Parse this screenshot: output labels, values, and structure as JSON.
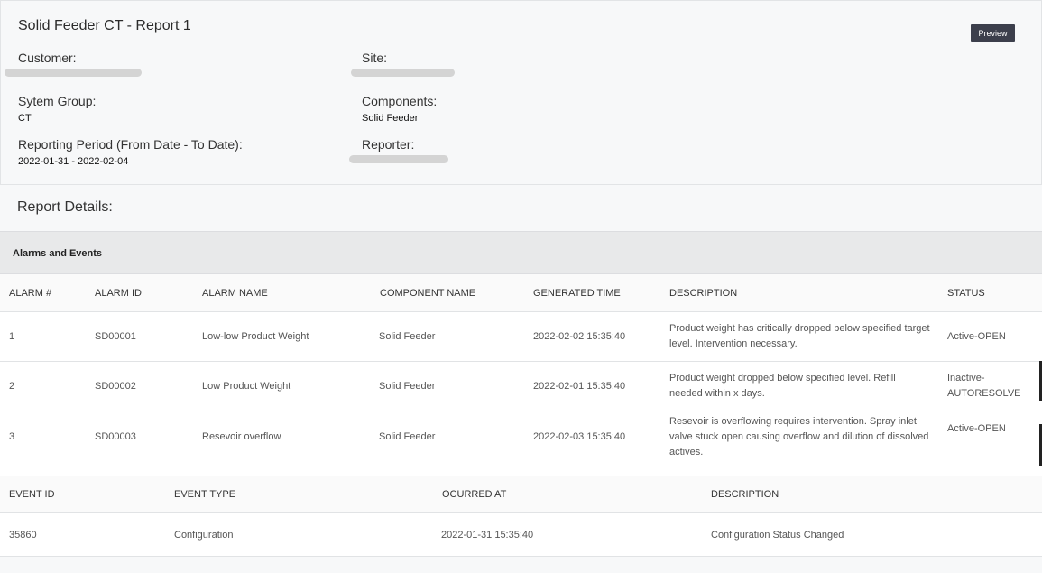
{
  "report": {
    "title": "Solid Feeder CT - Report 1",
    "preview_label": "Preview",
    "fields": {
      "customer_label": "Customer:",
      "site_label": "Site:",
      "system_group_label": "Sytem Group:",
      "system_group_value": "CT",
      "components_label": "Components:",
      "components_value": "Solid Feeder",
      "period_label": "Reporting Period (From Date - To Date):",
      "period_value": "2022-01-31 - 2022-02-04",
      "reporter_label": "Reporter:"
    },
    "details_title": "Report Details:"
  },
  "alarms": {
    "section_title": "Alarms and Events",
    "columns": [
      "ALARM #",
      "ALARM ID",
      "ALARM NAME",
      "COMPONENT NAME",
      "GENERATED TIME",
      "DESCRIPTION",
      "STATUS"
    ],
    "rows": [
      {
        "num": "1",
        "id": "SD00001",
        "name": "Low-low Product Weight",
        "component": "Solid Feeder",
        "time": "2022-02-02 15:35:40",
        "description": "Product weight has critically dropped below specified target level. Intervention necessary.",
        "status": "Active-OPEN"
      },
      {
        "num": "2",
        "id": "SD00002",
        "name": "Low Product Weight",
        "component": "Solid Feeder",
        "time": "2022-02-01 15:35:40",
        "description": "Product weight dropped below specified level. Refill needed within x days.",
        "status": "Inactive-AUTORESOLVE"
      },
      {
        "num": "3",
        "id": "SD00003",
        "name": "Resevoir overflow",
        "component": "Solid Feeder",
        "time": "2022-02-03 15:35:40",
        "description": "Resevoir is overflowing requires intervention. Spray inlet valve stuck open causing overflow and dilution of dissolved actives.",
        "status": "Active-OPEN"
      }
    ]
  },
  "events": {
    "columns": [
      "EVENT ID",
      "EVENT TYPE",
      "OCURRED AT",
      "DESCRIPTION"
    ],
    "rows": [
      {
        "id": "35860",
        "type": "Configuration",
        "occurred": "2022-01-31 15:35:40",
        "description": "Configuration Status Changed"
      }
    ]
  }
}
